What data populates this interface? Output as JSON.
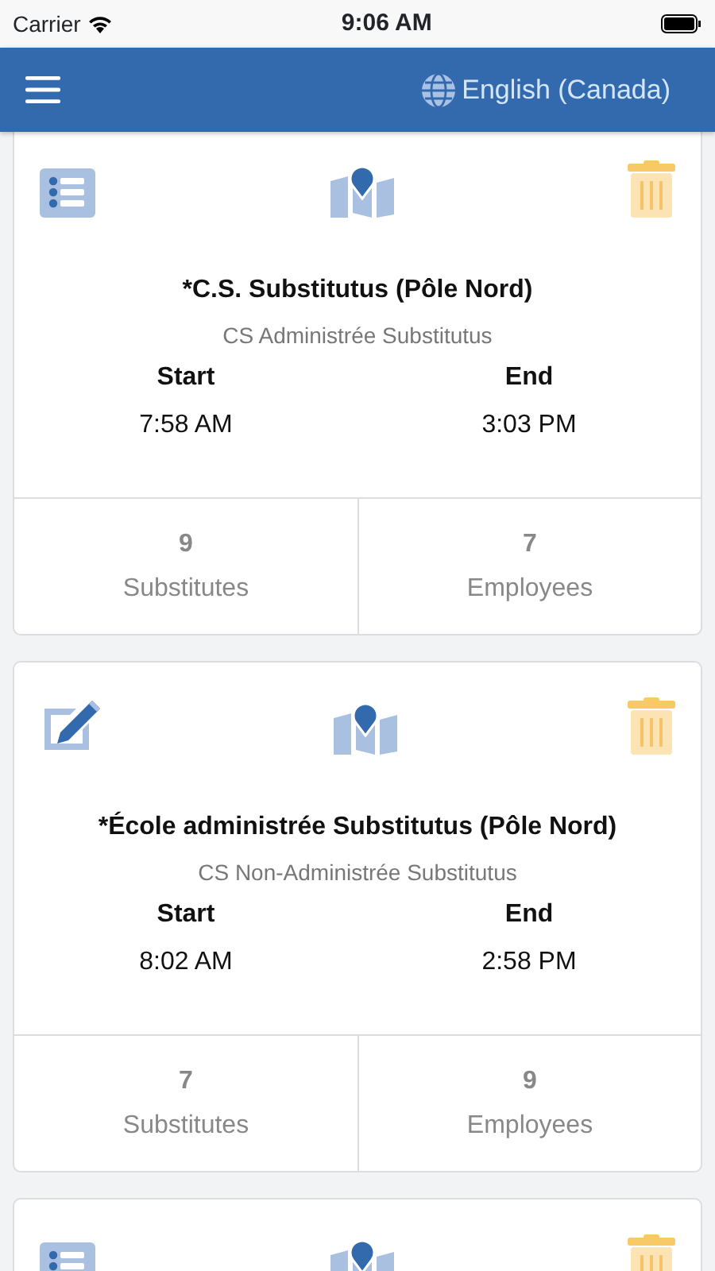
{
  "status_bar": {
    "carrier": "Carrier",
    "time": "9:06 AM"
  },
  "navbar": {
    "language": "English (Canada)"
  },
  "cards": [
    {
      "kind": "list",
      "title": "*C.S. Substitutus (Pôle Nord)",
      "subtitle": "CS Administrée Substitutus",
      "start_label": "Start",
      "start": "7:58 AM",
      "end_label": "End",
      "end": "3:03 PM",
      "stats": [
        {
          "count": "9",
          "label": "Substitutes"
        },
        {
          "count": "7",
          "label": "Employees"
        }
      ]
    },
    {
      "kind": "edit",
      "title": "*École administrée Substitutus (Pôle Nord)",
      "subtitle": "CS Non-Administrée Substitutus",
      "start_label": "Start",
      "start": "8:02 AM",
      "end_label": "End",
      "end": "2:58 PM",
      "stats": [
        {
          "count": "7",
          "label": "Substitutes"
        },
        {
          "count": "9",
          "label": "Employees"
        }
      ]
    },
    {
      "kind": "list"
    }
  ]
}
